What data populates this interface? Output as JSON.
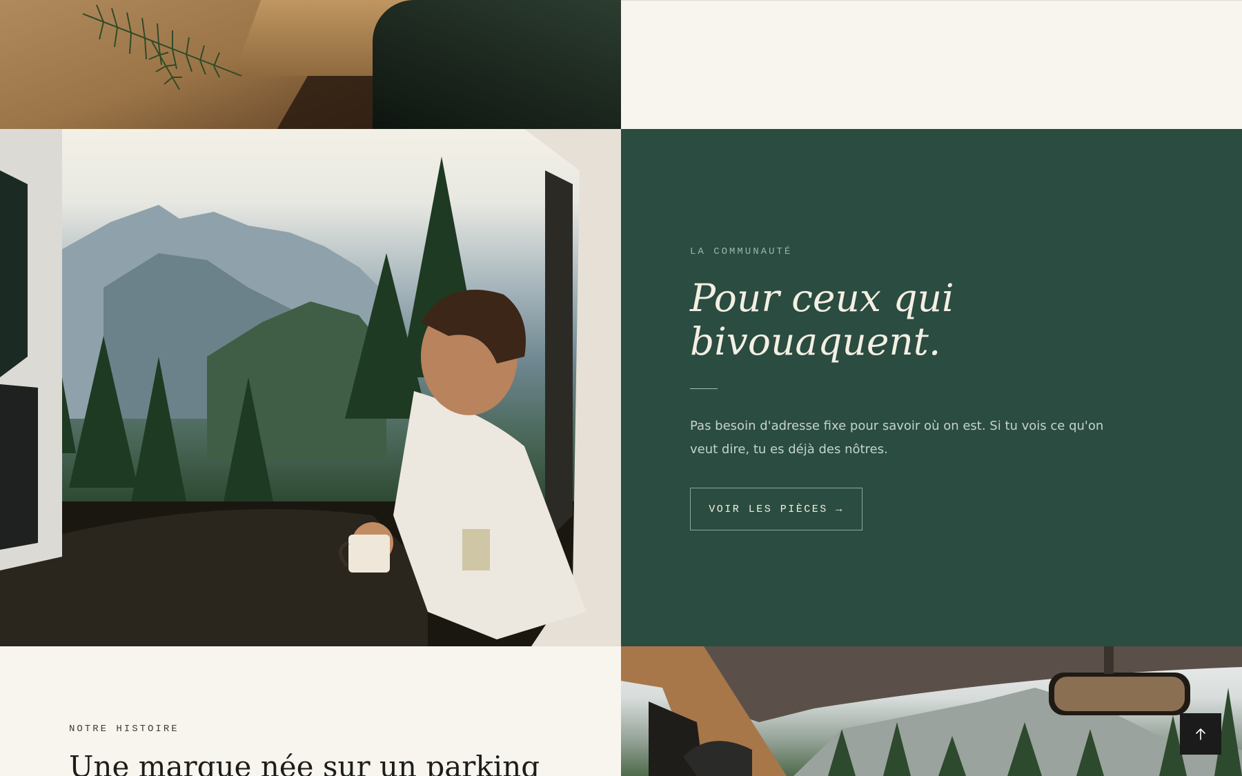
{
  "community": {
    "eyebrow": "LA COMMUNAUTÉ",
    "heading_line1": "Pour ceux qui",
    "heading_line2": "bivouaquent.",
    "body": "Pas besoin d'adresse fixe pour savoir où on est. Si tu vois ce qu'on veut dire, tu es déjà des nôtres.",
    "cta_label": "VOIR LES PIÈCES →"
  },
  "story": {
    "eyebrow": "NOTRE HISTOIRE",
    "heading": "Une marque née sur un parking"
  },
  "colors": {
    "cream": "#f8f5ef",
    "forest_green": "#2b4c40",
    "cta_border": "#8fa89c",
    "back_to_top_bg": "#1b1b1b"
  },
  "icons": {
    "back_to_top": "arrow-up-icon"
  }
}
